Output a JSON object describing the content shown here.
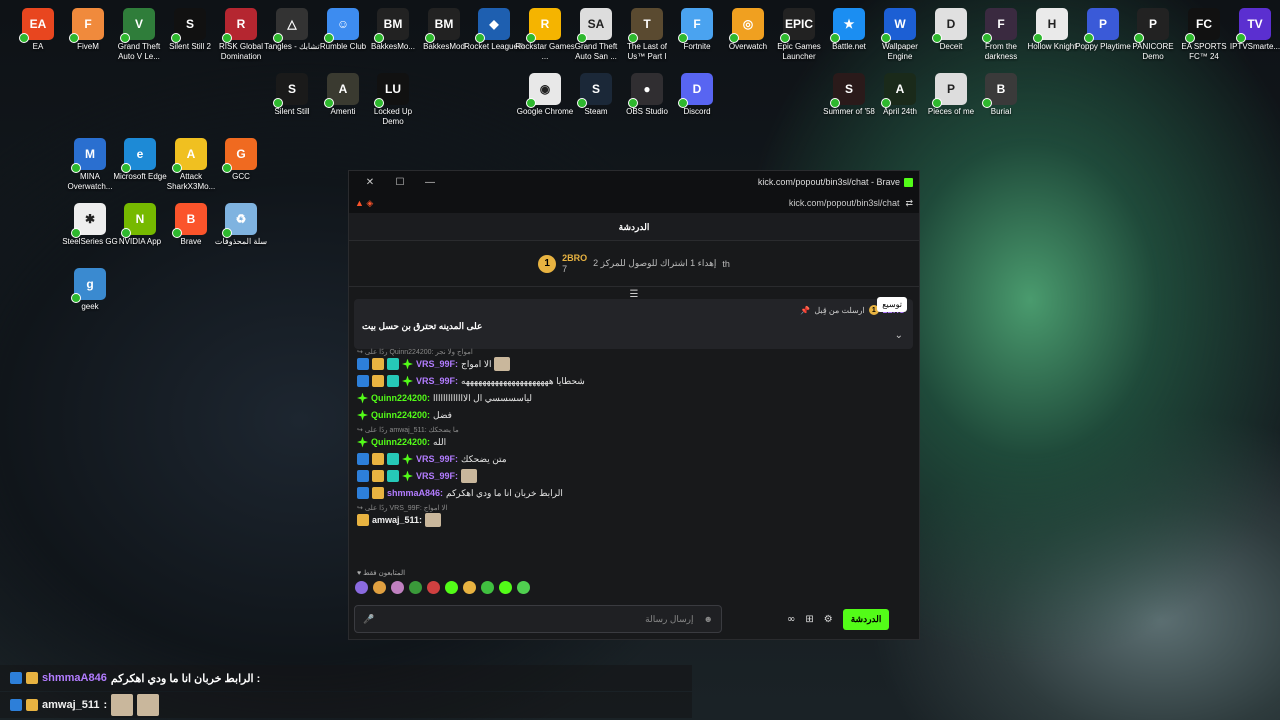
{
  "desktop": {
    "icons": [
      {
        "label": "EA",
        "color": "#e8461f",
        "glyph": "EA"
      },
      {
        "label": "FiveM",
        "color": "#f08a3c",
        "glyph": "F"
      },
      {
        "label": "Grand Theft Auto V Le...",
        "color": "#2f7d3a",
        "glyph": "V"
      },
      {
        "label": "Silent Still 2",
        "color": "#111",
        "glyph": "S"
      },
      {
        "label": "RISK Global Domination",
        "color": "#b52630",
        "glyph": "R"
      },
      {
        "label": "Tangles - تشابك",
        "color": "#333",
        "glyph": "△"
      },
      {
        "label": "Rumble Club",
        "color": "#3d8cf0",
        "glyph": "☺"
      },
      {
        "label": "BakkesMo...",
        "color": "#222",
        "glyph": "BM"
      },
      {
        "label": "BakkesMod",
        "color": "#222",
        "glyph": "BM"
      },
      {
        "label": "Rocket League®",
        "color": "#1e5fb0",
        "glyph": "◆"
      },
      {
        "label": "Rockstar Games ...",
        "color": "#f5b400",
        "glyph": "R"
      },
      {
        "label": "Grand Theft Auto San ...",
        "color": "#ddd",
        "glyph": "SA"
      },
      {
        "label": "The Last of Us™ Part I",
        "color": "#5a4a30",
        "glyph": "T"
      },
      {
        "label": "Fortnite",
        "color": "#4aa3f0",
        "glyph": "F"
      },
      {
        "label": "Overwatch",
        "color": "#f0a020",
        "glyph": "◎"
      },
      {
        "label": "Epic Games Launcher",
        "color": "#222",
        "glyph": "EPIC"
      },
      {
        "label": "Battle.net",
        "color": "#1b8ef2",
        "glyph": "★"
      },
      {
        "label": "Wallpaper Engine",
        "color": "#1c5fd4",
        "glyph": "W"
      },
      {
        "label": "Deceit",
        "color": "#e0e0e0",
        "glyph": "D"
      },
      {
        "label": "From the darkness",
        "color": "#3a2a40",
        "glyph": "F"
      },
      {
        "label": "Hollow Knight",
        "color": "#eaeaea",
        "glyph": "H"
      },
      {
        "label": "Poppy Playtime",
        "color": "#3a5ad8",
        "glyph": "P"
      },
      {
        "label": "PANICORE Demo",
        "color": "#222",
        "glyph": "P"
      },
      {
        "label": "EA SPORTS FC™ 24",
        "color": "#111",
        "glyph": "FC"
      },
      {
        "label": "IPTVSmarte...",
        "color": "#5b2fd0",
        "glyph": "TV"
      },
      {
        "label": "Silent Still",
        "color": "#1a1a1a",
        "glyph": "S"
      },
      {
        "label": "Amenti",
        "color": "#3a3a30",
        "glyph": "A"
      },
      {
        "label": "Locked Up Demo",
        "color": "#111",
        "glyph": "LU"
      },
      {
        "label": "Google Chrome",
        "color": "#e8e8e8",
        "glyph": "◉"
      },
      {
        "label": "Steam",
        "color": "#1b2838",
        "glyph": "S"
      },
      {
        "label": "OBS Studio",
        "color": "#302e31",
        "glyph": "●"
      },
      {
        "label": "Discord",
        "color": "#5865f2",
        "glyph": "D"
      },
      {
        "label": "Summer of '58",
        "color": "#2a1a1a",
        "glyph": "S"
      },
      {
        "label": "April 24th",
        "color": "#1a2a1a",
        "glyph": "A"
      },
      {
        "label": "Pieces of me",
        "color": "#ddd",
        "glyph": "P"
      },
      {
        "label": "Burial",
        "color": "#3a3a3a",
        "glyph": "B"
      },
      {
        "label": "MINA Overwatch...",
        "color": "#2a6fd0",
        "glyph": "M"
      },
      {
        "label": "Microsoft Edge",
        "color": "#1d8ad6",
        "glyph": "e"
      },
      {
        "label": "Attack SharkX3Mo...",
        "color": "#f0c020",
        "glyph": "A"
      },
      {
        "label": "GCC",
        "color": "#f06a20",
        "glyph": "G"
      },
      {
        "label": "SteelSeries GG",
        "color": "#eee",
        "glyph": "✱"
      },
      {
        "label": "NVIDIA App",
        "color": "#76b900",
        "glyph": "N"
      },
      {
        "label": "Brave",
        "color": "#fb542b",
        "glyph": "B"
      },
      {
        "label": "سلة المحذوفات",
        "color": "#7fb3e0",
        "glyph": "♻"
      },
      {
        "label": "geek",
        "color": "#3a8ad0",
        "glyph": "g"
      }
    ]
  },
  "browser": {
    "title": "kick.com/popout/bin3sl/chat - Brave",
    "url": "kick.com/popout/bin3sl/chat",
    "close": "✕",
    "maximize": "☐",
    "minimize": "—"
  },
  "chat": {
    "header": "الدردشة",
    "goal": {
      "rank": "1",
      "user": "2BRO",
      "count": "7",
      "text": "إهداء 1 اشتراك للوصول للمركز 2",
      "suffix": "th"
    },
    "pinned": {
      "by": "ارسلت من قِبل",
      "user": "2BRO",
      "message": "على المدينه تحترق بن حسل بيت",
      "tooltip": "توسيع"
    },
    "messages": [
      {
        "type": "reply",
        "text": "ردًا على Quinn224200: امواج ولا نجر"
      },
      {
        "user": "VRS_99F:",
        "cls": "u-vrs",
        "badges": [
          "blue",
          "gold",
          "teal",
          "green"
        ],
        "text": "الا امواج",
        "emote": true
      },
      {
        "user": "VRS_99F:",
        "cls": "u-vrs",
        "badges": [
          "blue",
          "gold",
          "teal",
          "green"
        ],
        "text": "شحطايا هههههههههههههههههههههه"
      },
      {
        "user": "Quinn224200:",
        "cls": "u-q",
        "badges": [
          "green"
        ],
        "text": "لياسسسسي ال الااااااااااااا"
      },
      {
        "user": "Quinn224200:",
        "cls": "u-q",
        "badges": [
          "green"
        ],
        "text": "فضل"
      },
      {
        "type": "reply",
        "text": "ردًا على amwaj_511: ما يضحكك"
      },
      {
        "user": "Quinn224200:",
        "cls": "u-q",
        "badges": [
          "green"
        ],
        "text": "الله"
      },
      {
        "user": "VRS_99F:",
        "cls": "u-vrs",
        "badges": [
          "blue",
          "gold",
          "teal",
          "green"
        ],
        "text": "متن يضحكك"
      },
      {
        "user": "VRS_99F:",
        "cls": "u-vrs",
        "badges": [
          "blue",
          "gold",
          "teal",
          "green"
        ],
        "text": "",
        "emote": true
      },
      {
        "user": "shmmaA846:",
        "cls": "u-s",
        "badges": [
          "blue",
          "gold"
        ],
        "text": "الرابط خربان انا ما ودي اهكركم"
      },
      {
        "type": "reply",
        "text": "ردًا على VRS_99F: الا امواج"
      },
      {
        "user": "amwaj_511:",
        "cls": "u-a",
        "badges": [
          "gold"
        ],
        "text": "",
        "emote": true
      }
    ],
    "subs_label": "♥ المتابعون فقط",
    "emotes": [
      "#8a6adf",
      "#e0a040",
      "#c080c0",
      "#3a9a3a",
      "#d04040",
      "#53fc18",
      "#e8b341",
      "#40c040",
      "#53fc18",
      "#50d050"
    ],
    "input_placeholder": "إرسال رسالة",
    "send_label": "الدردشة"
  },
  "overlay": [
    {
      "user": "shmmaA846",
      "text": "الرابط خربان انا ما ودي اهكركم :",
      "emotes": 0
    },
    {
      "user": "amwaj_511",
      "text": ":",
      "emotes": 2
    }
  ]
}
